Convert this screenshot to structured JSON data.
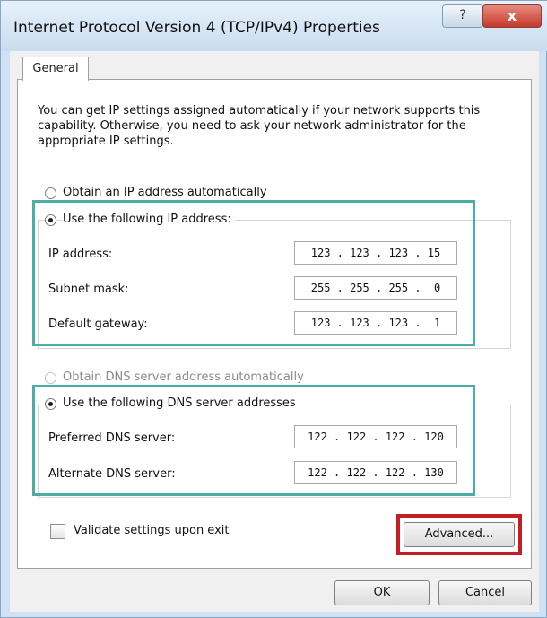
{
  "window": {
    "title": "Internet Protocol Version 4 (TCP/IPv4) Properties",
    "help_glyph": "?",
    "close_glyph": "x"
  },
  "tabs": [
    {
      "label": "General",
      "selected": true
    }
  ],
  "intro_text": "You can get IP settings assigned automatically if your network supports this capability. Otherwise, you need to ask your network administrator for the appropriate IP settings.",
  "ip_section": {
    "auto_label": "Obtain an IP address automatically",
    "auto_selected": false,
    "manual_label": "Use the following IP address:",
    "manual_selected": true,
    "fields": [
      {
        "label": "IP address:",
        "value": "123 . 123 . 123 . 15"
      },
      {
        "label": "Subnet mask:",
        "value": "255 . 255 . 255 .  0"
      },
      {
        "label": "Default gateway:",
        "value": "123 . 123 . 123 .  1"
      }
    ]
  },
  "dns_section": {
    "auto_label": "Obtain DNS server address automatically",
    "auto_enabled": false,
    "manual_label": "Use the following DNS server addresses",
    "manual_selected": true,
    "fields": [
      {
        "label": "Preferred DNS server:",
        "value": "122 . 122 . 122 . 120"
      },
      {
        "label": "Alternate DNS server:",
        "value": "122 . 122 . 122 . 130"
      }
    ]
  },
  "validate": {
    "label": "Validate settings upon exit",
    "checked": false
  },
  "buttons": {
    "advanced": "Advanced...",
    "ok": "OK",
    "cancel": "Cancel"
  },
  "colors": {
    "highlight_teal": "#4aaea4",
    "highlight_red": "#c21e24"
  }
}
